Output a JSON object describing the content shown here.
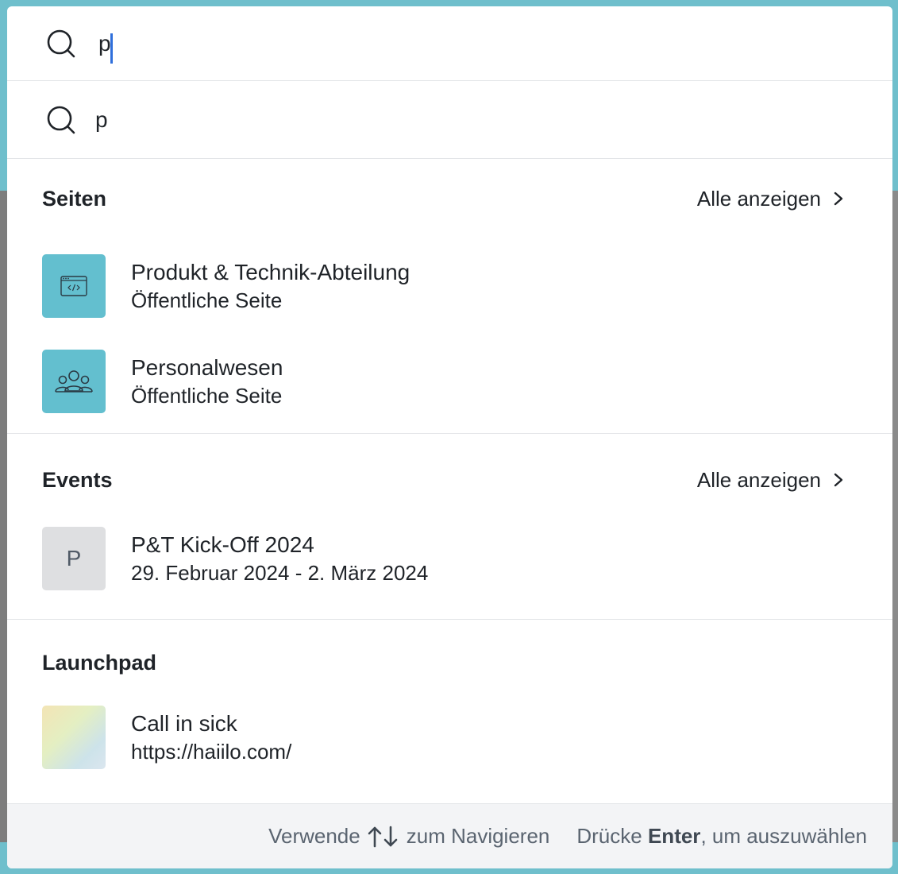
{
  "search": {
    "value": "p",
    "icon": "search-icon"
  },
  "suggestion": {
    "text": "p",
    "icon": "search-icon"
  },
  "sections": {
    "pages": {
      "title": "Seiten",
      "show_all": "Alle anzeigen",
      "items": [
        {
          "title": "Produkt & Technik-Abteilung",
          "subtitle": "Öffentliche Seite",
          "icon": "code-window-icon"
        },
        {
          "title": "Personalwesen",
          "subtitle": "Öffentliche Seite",
          "icon": "people-group-icon"
        }
      ]
    },
    "events": {
      "title": "Events",
      "show_all": "Alle anzeigen",
      "items": [
        {
          "title": "P&T Kick-Off 2024",
          "subtitle": "29. Februar 2024 - 2. März 2024",
          "thumb_letter": "P"
        }
      ]
    },
    "launchpad": {
      "title": "Launchpad",
      "items": [
        {
          "title": "Call in sick",
          "subtitle": "https://haiilo.com/"
        }
      ]
    }
  },
  "footer": {
    "use": "Verwende",
    "navigate": "zum Navigieren",
    "press": "Drücke",
    "enter": "Enter",
    "select": ", um auszuwählen"
  },
  "colors": {
    "accent_teal": "#63bfcf",
    "caret": "#2f6fdb",
    "footer_bg": "#f3f4f6"
  }
}
